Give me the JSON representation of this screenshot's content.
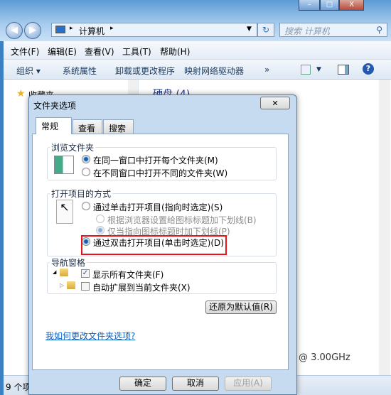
{
  "explorer": {
    "window_controls": {
      "minimize": "–",
      "maximize": "□",
      "close": "X"
    },
    "address": {
      "path": "计算机",
      "separator": "▸"
    },
    "search_placeholder": "搜索 计算机",
    "menu": [
      "文件(F)",
      "编辑(E)",
      "查看(V)",
      "工具(T)",
      "帮助(H)"
    ],
    "toolbar": {
      "organize": "组织 ▾",
      "system_properties": "系统属性",
      "uninstall": "卸载或更改程序",
      "map_drive": "映射网络驱动器",
      "more": "»",
      "help": "?"
    },
    "nav": {
      "favorites": "收藏夹"
    },
    "main": {
      "group_header": "硬盘 (4)",
      "cpu_info": "@ 3.00GHz"
    },
    "status": "9 个项"
  },
  "dialog": {
    "title": "文件夹选项",
    "close": "✕",
    "tabs": [
      {
        "label": "常规",
        "active": true
      },
      {
        "label": "查看"
      },
      {
        "label": "搜索"
      }
    ],
    "browse": {
      "label": "浏览文件夹",
      "options": [
        {
          "label": "在同一窗口中打开每个文件夹(M)",
          "selected": true
        },
        {
          "label": "在不同窗口中打开不同的文件夹(W)",
          "selected": false
        }
      ]
    },
    "open": {
      "label": "打开项目的方式",
      "single": {
        "label": "通过单击打开项目(指向时选定)(S)",
        "selected": false
      },
      "sub": [
        {
          "label": "根据浏览器设置给图标标题加下划线(B)",
          "selected": false
        },
        {
          "label": "仅当指向图标标题时加下划线(P)",
          "selected": true
        }
      ],
      "double": {
        "label": "通过双击打开项目(单击时选定)(D)",
        "selected": true
      }
    },
    "nav": {
      "label": "导航窗格",
      "options": [
        {
          "label": "显示所有文件夹(F)",
          "checked": true
        },
        {
          "label": "自动扩展到当前文件夹(X)",
          "checked": false
        }
      ]
    },
    "restore": "还原为默认值(R)",
    "help_link": "我如何更改文件夹选项?",
    "ok": "确定",
    "cancel": "取消",
    "apply": "应用(A)",
    "highlight_color": "#e8141b"
  }
}
